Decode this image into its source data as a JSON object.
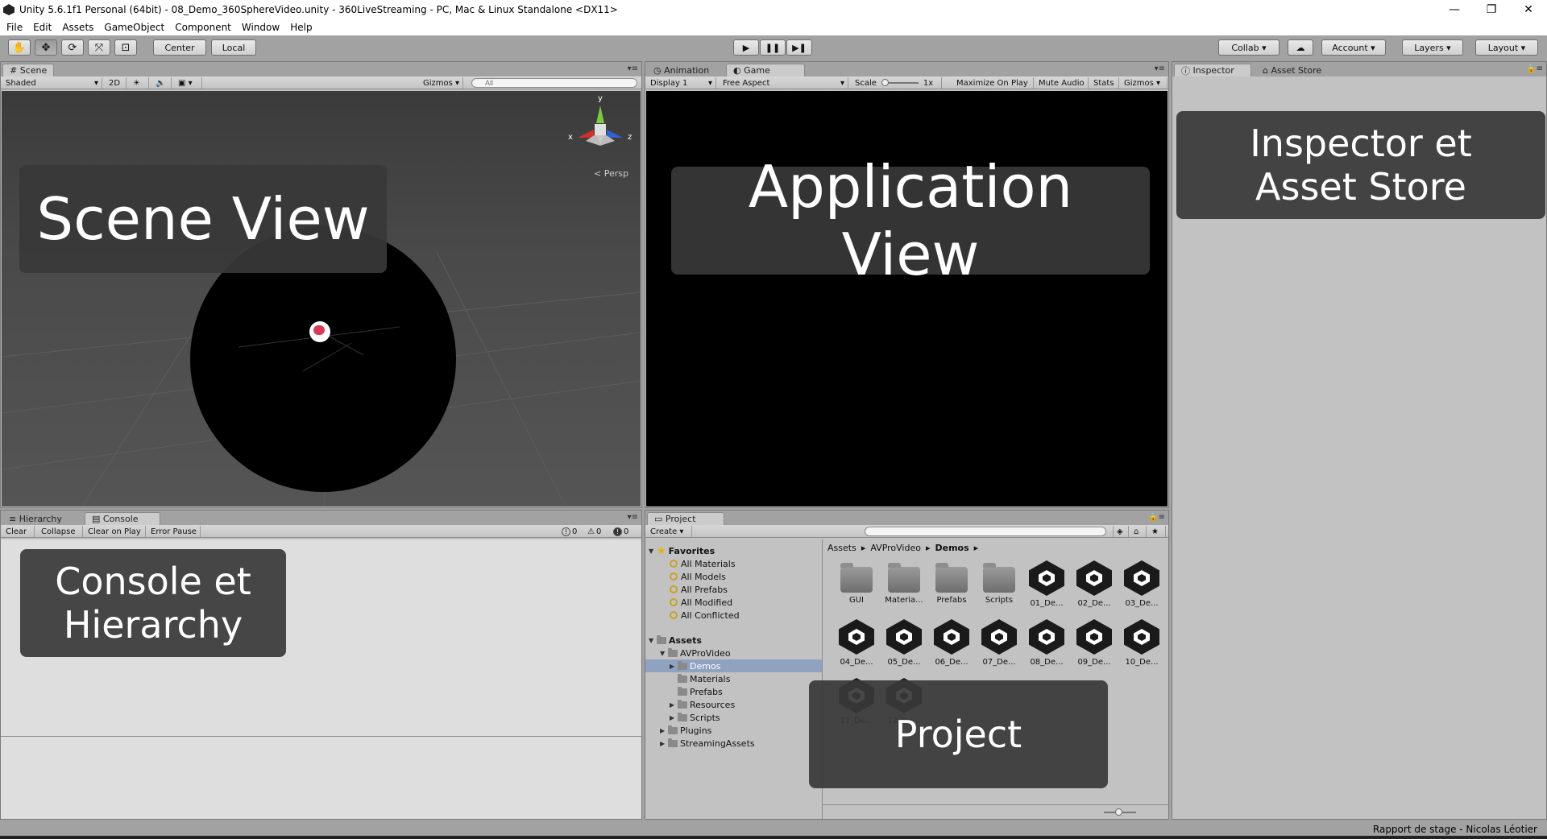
{
  "window": {
    "title": "Unity 5.6.1f1 Personal (64bit) - 08_Demo_360SphereVideo.unity - 360LiveStreaming - PC, Mac & Linux Standalone <DX11>",
    "minimize": "—",
    "restore": "❐",
    "close": "✕"
  },
  "menu": [
    "File",
    "Edit",
    "Assets",
    "GameObject",
    "Component",
    "Window",
    "Help"
  ],
  "toolbar": {
    "tools": [
      {
        "icon": "hand-icon",
        "glyph": "✋"
      },
      {
        "icon": "move-icon",
        "glyph": "✥"
      },
      {
        "icon": "rotate-icon",
        "glyph": "⟳"
      },
      {
        "icon": "scale-icon",
        "glyph": "⤧"
      },
      {
        "icon": "rect-icon",
        "glyph": "⊡"
      }
    ],
    "pivot": "Center",
    "space": "Local",
    "play": "▶",
    "pause": "❚❚",
    "step": "▶❚",
    "collab": "Collab ▾",
    "cloud": "☁",
    "account": "Account",
    "layers": "Layers",
    "layout": "Layout"
  },
  "scene": {
    "tab": "Scene",
    "shading": "Shaded",
    "mode2d": "2D",
    "gizmos": "Gizmos",
    "search_placeholder": "All",
    "persp": "Persp",
    "axis_x": "x",
    "axis_y": "y",
    "axis_z": "z"
  },
  "game": {
    "tab_animation": "Animation",
    "tab_game": "Game",
    "display": "Display 1",
    "aspect": "Free Aspect",
    "scale_label": "Scale",
    "scale_value": "1x",
    "maximize": "Maximize On Play",
    "mute": "Mute Audio",
    "stats": "Stats",
    "gizmos": "Gizmos"
  },
  "inspector": {
    "tab_inspector": "Inspector",
    "tab_store": "Asset Store"
  },
  "console": {
    "tab_hierarchy": "Hierarchy",
    "tab_console": "Console",
    "clear": "Clear",
    "collapse": "Collapse",
    "clear_on_play": "Clear on Play",
    "error_pause": "Error Pause",
    "info_count": "0",
    "warn_count": "0",
    "error_count": "0"
  },
  "project": {
    "tab": "Project",
    "create": "Create",
    "favorites_label": "Favorites",
    "favorites": [
      "All Materials",
      "All Models",
      "All Prefabs",
      "All Modified",
      "All Conflicted"
    ],
    "assets_label": "Assets",
    "tree": [
      {
        "label": "AVProVideo",
        "depth": 1,
        "fold": "▼"
      },
      {
        "label": "Demos",
        "depth": 2,
        "fold": "▶",
        "selected": true
      },
      {
        "label": "Materials",
        "depth": 2,
        "fold": ""
      },
      {
        "label": "Prefabs",
        "depth": 2,
        "fold": ""
      },
      {
        "label": "Resources",
        "depth": 2,
        "fold": "▶"
      },
      {
        "label": "Scripts",
        "depth": 2,
        "fold": "▶"
      },
      {
        "label": "Plugins",
        "depth": 1,
        "fold": "▶"
      },
      {
        "label": "StreamingAssets",
        "depth": 1,
        "fold": "▶"
      }
    ],
    "breadcrumb": [
      "Assets",
      "AVProVideo",
      "Demos"
    ],
    "items": [
      {
        "label": "GUI",
        "kind": "folder"
      },
      {
        "label": "Materia...",
        "kind": "folder"
      },
      {
        "label": "Prefabs",
        "kind": "folder"
      },
      {
        "label": "Scripts",
        "kind": "folder"
      },
      {
        "label": "01_De...",
        "kind": "unity"
      },
      {
        "label": "02_De...",
        "kind": "unity"
      },
      {
        "label": "03_De...",
        "kind": "unity"
      },
      {
        "label": "04_De...",
        "kind": "unity"
      },
      {
        "label": "05_De...",
        "kind": "unity"
      },
      {
        "label": "06_De...",
        "kind": "unity"
      },
      {
        "label": "07_De...",
        "kind": "unity"
      },
      {
        "label": "08_De...",
        "kind": "unity"
      },
      {
        "label": "09_De...",
        "kind": "unity"
      },
      {
        "label": "10_De...",
        "kind": "unity"
      },
      {
        "label": "11_De...",
        "kind": "unity"
      },
      {
        "label": "12_De...",
        "kind": "unity"
      }
    ]
  },
  "overlays": {
    "scene": "Scene View",
    "app": "Application View",
    "inspector_line1": "Inspector et",
    "inspector_line2": "Asset Store",
    "console_line1": "Console et",
    "console_line2": "Hierarchy",
    "project": "Project"
  },
  "status": {
    "text": "Rapport de stage - Nicolas Léotier"
  }
}
